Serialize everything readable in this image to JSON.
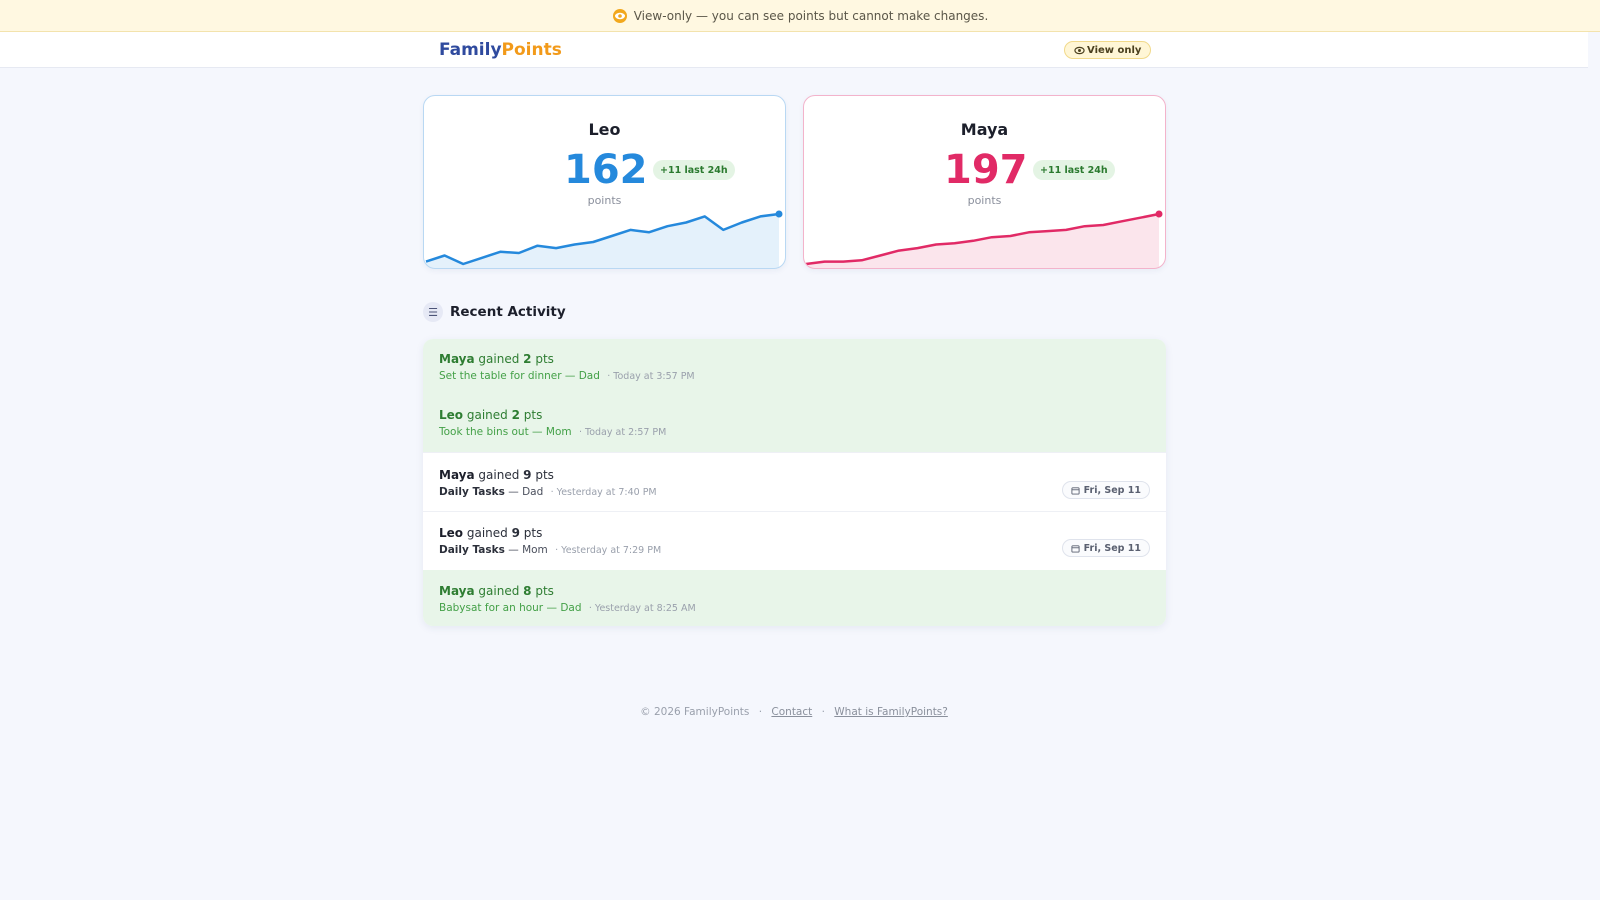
{
  "banner": {
    "icon": "eye-icon",
    "text": "View-only — you can see points but cannot make changes."
  },
  "header": {
    "logo_part1": "Family",
    "logo_part2": "Points",
    "view_badge": "View only",
    "colors": {
      "logo_primary": "#2f4a9e",
      "logo_accent": "#f29a1a"
    }
  },
  "cards": [
    {
      "name": "Leo",
      "points": "162",
      "delta": "+11 last 24h",
      "unit": "points",
      "color": "#2589dc",
      "trend": [
        3,
        8,
        1,
        6,
        11,
        10,
        16,
        14,
        17,
        19,
        24,
        29,
        27,
        32,
        35,
        40,
        29,
        35,
        40,
        42
      ]
    },
    {
      "name": "Maya",
      "points": "197",
      "delta": "+11 last 24h",
      "unit": "points",
      "color": "#e12a66",
      "trend": [
        2,
        4,
        4,
        5,
        9,
        13,
        15,
        18,
        19,
        21,
        24,
        25,
        28,
        29,
        30,
        33,
        34,
        37,
        40,
        43
      ]
    }
  ],
  "activity": {
    "title": "Recent Activity",
    "icon": "list-icon",
    "items": [
      {
        "person": "Maya",
        "verb": "gained",
        "points": "2",
        "unit": "pts",
        "task": "Set the table for dinner",
        "by": "Dad",
        "time": "· Today at 3:57 PM",
        "style": "green",
        "date": ""
      },
      {
        "person": "Leo",
        "verb": "gained",
        "points": "2",
        "unit": "pts",
        "task": "Took the bins out",
        "by": "Mom",
        "time": "· Today at 2:57 PM",
        "style": "green",
        "date": ""
      },
      {
        "person": "Maya",
        "verb": "gained",
        "points": "9",
        "unit": "pts",
        "task": "Daily Tasks",
        "by": "Dad",
        "time": "· Yesterday at 7:40 PM",
        "style": "white",
        "date": "Fri, Sep 11"
      },
      {
        "person": "Leo",
        "verb": "gained",
        "points": "9",
        "unit": "pts",
        "task": "Daily Tasks",
        "by": "Mom",
        "time": "· Yesterday at 7:29 PM",
        "style": "white",
        "date": "Fri, Sep 11"
      },
      {
        "person": "Maya",
        "verb": "gained",
        "points": "8",
        "unit": "pts",
        "task": "Babysat for an hour",
        "by": "Dad",
        "time": "· Yesterday at 8:25 AM",
        "style": "green",
        "date": ""
      }
    ]
  },
  "footer": {
    "copyright": "© 2026 FamilyPoints",
    "contact": "Contact",
    "about": "What is FamilyPoints?"
  }
}
